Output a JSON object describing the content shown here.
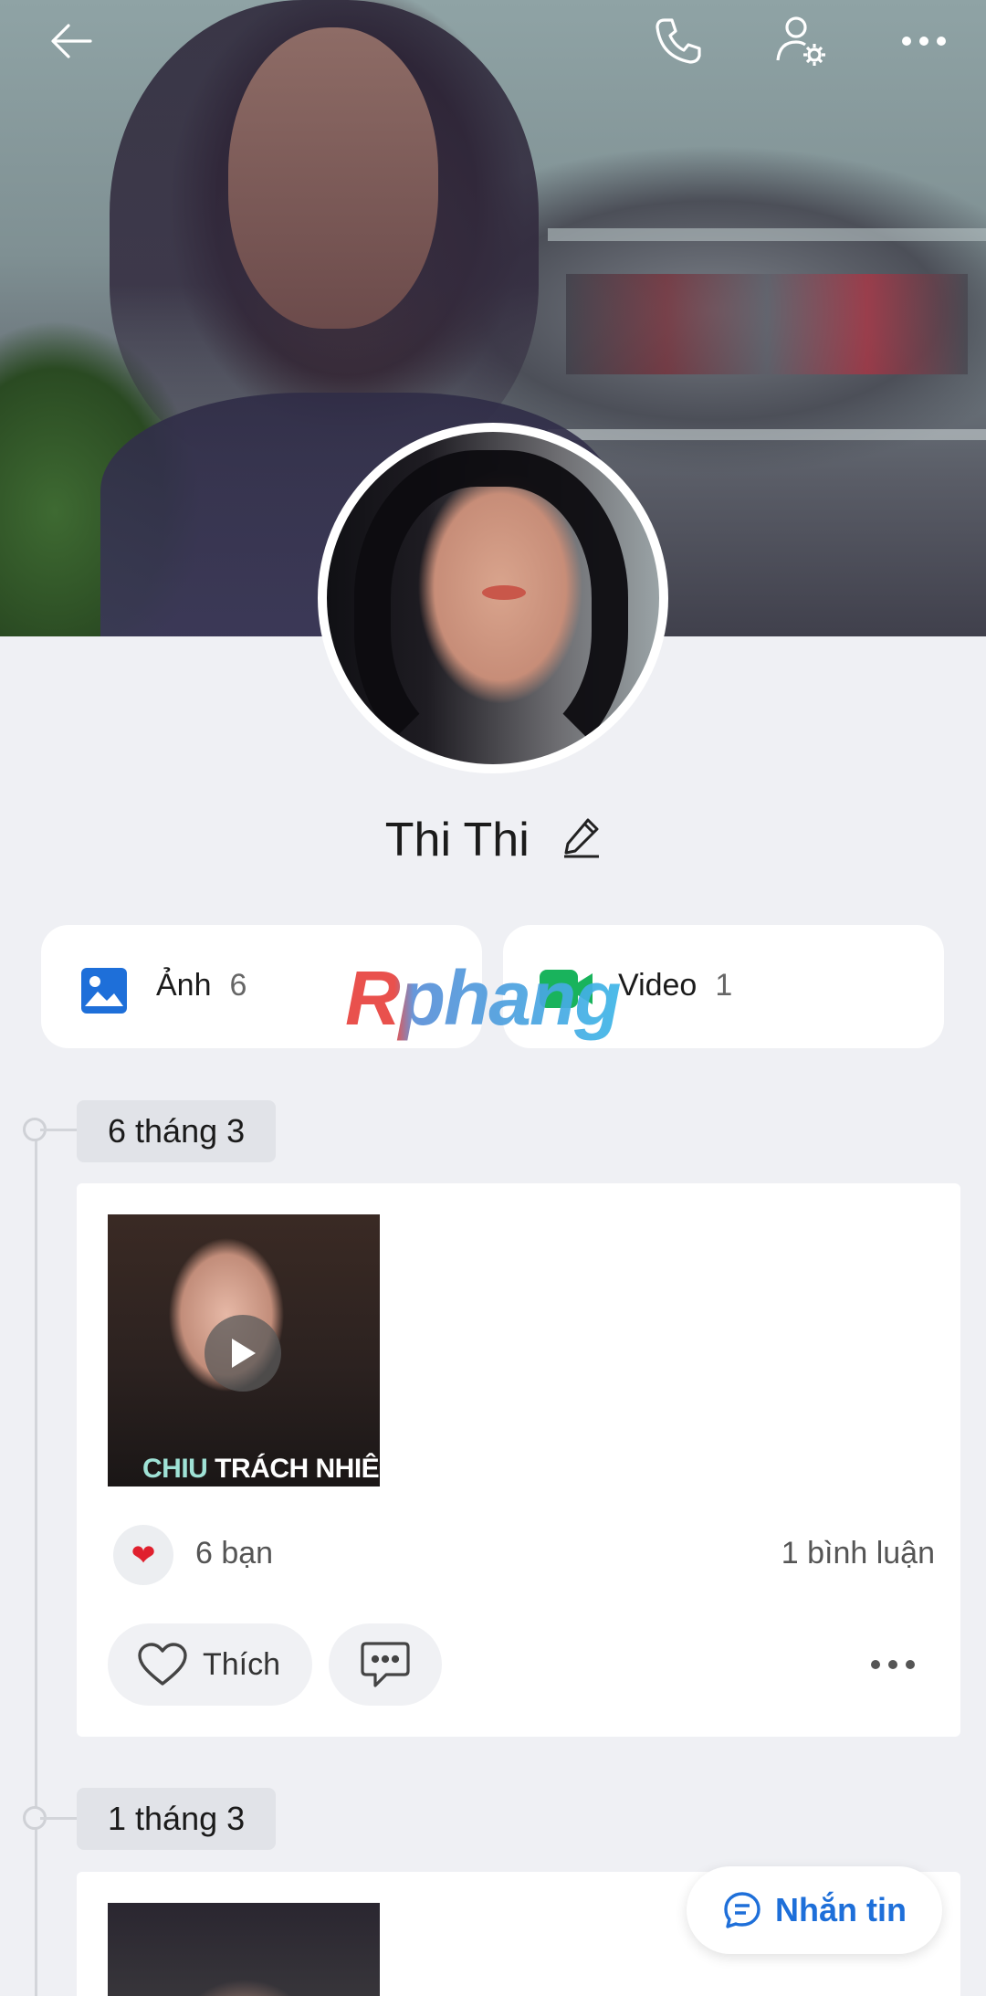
{
  "profile": {
    "name": "Thi Thi"
  },
  "media": {
    "photos_label": "Ảnh",
    "photos_count": "6",
    "videos_label": "Video",
    "videos_count": "1"
  },
  "watermark": "Rphang",
  "timeline": [
    {
      "date": "6 tháng 3",
      "thumb_caption_highlight": "CHIU",
      "thumb_caption_rest": " TRÁCH NHIÊM",
      "reactions": "6 bạn",
      "comments": "1 bình luận",
      "like_label": "Thích"
    },
    {
      "date": "1 tháng 3"
    }
  ],
  "message_button": "Nhắn tin",
  "colors": {
    "accent": "#1e6fd9",
    "heart": "#e0202e",
    "background": "#eff0f4"
  },
  "icons": [
    "back-arrow-icon",
    "phone-icon",
    "user-settings-icon",
    "more-icon",
    "edit-icon",
    "photo-icon",
    "video-icon",
    "play-icon",
    "heart-icon",
    "comment-icon",
    "message-icon"
  ]
}
